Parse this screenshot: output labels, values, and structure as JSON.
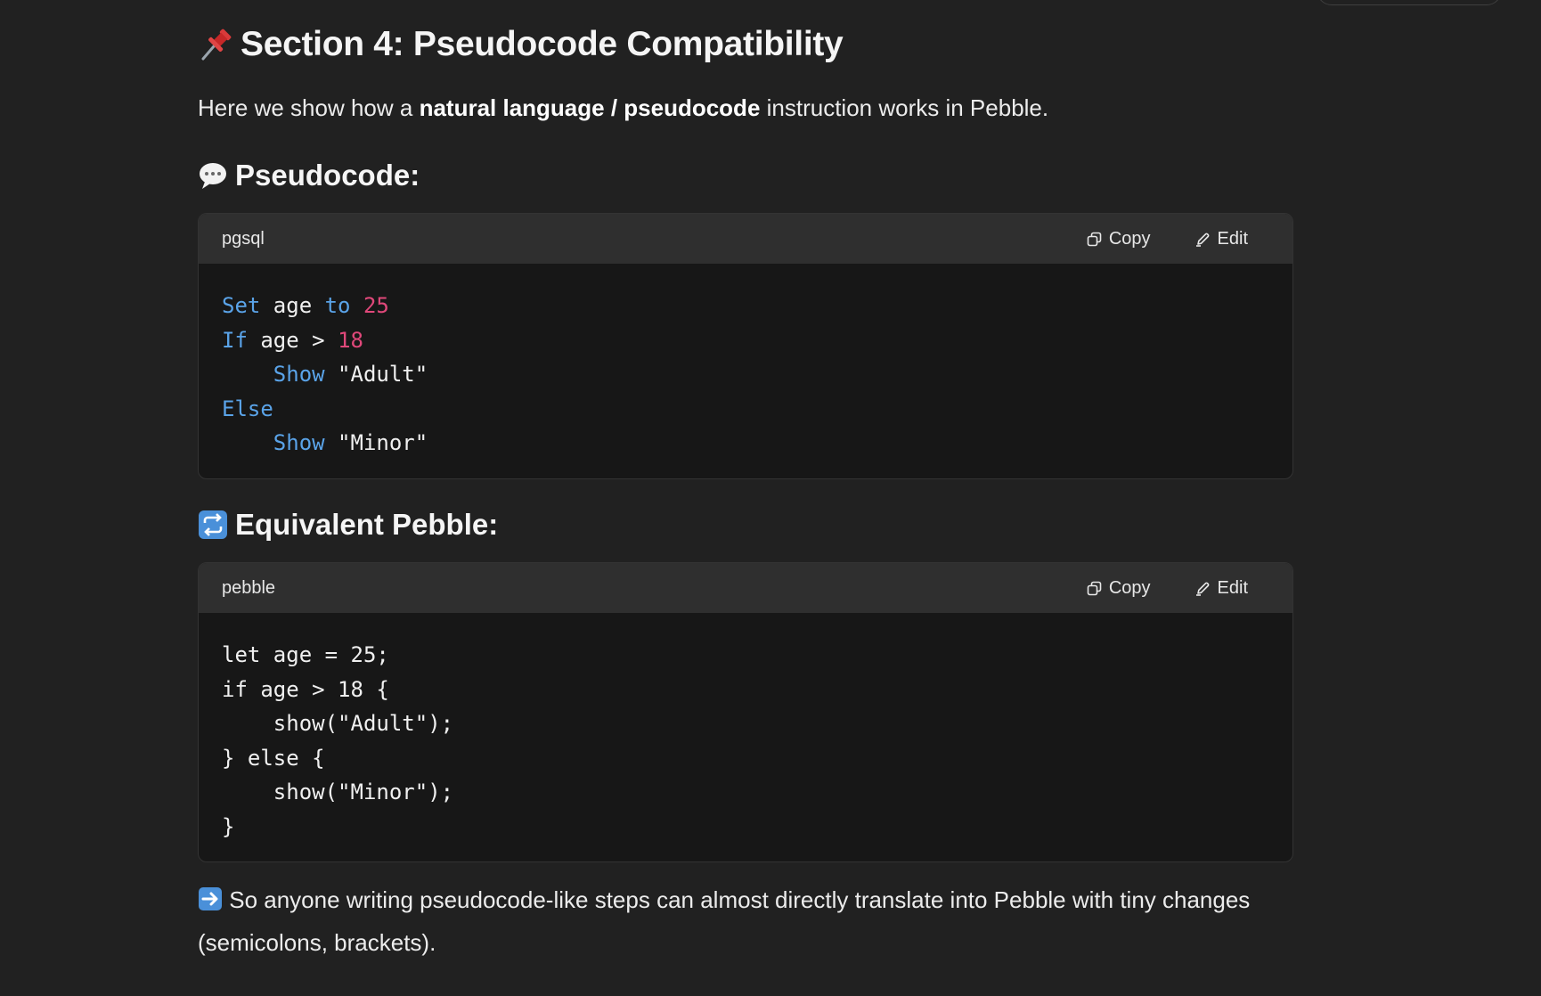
{
  "section": {
    "emoji": "📌",
    "title": "Section 4: Pseudocode Compatibility"
  },
  "intro": {
    "before": "Here we show how a ",
    "bold": "natural language / pseudocode",
    "after": " instruction works in Pebble."
  },
  "pseudocode_heading": {
    "emoji": "💬",
    "text": "Pseudocode:"
  },
  "pseudocode_block": {
    "language": "pgsql",
    "copy_label": "Copy",
    "edit_label": "Edit",
    "lines": [
      [
        {
          "t": "Set",
          "c": "kw"
        },
        {
          "t": " age "
        },
        {
          "t": "to",
          "c": "kw"
        },
        {
          "t": " "
        },
        {
          "t": "25",
          "c": "num"
        }
      ],
      [
        {
          "t": "If",
          "c": "kw"
        },
        {
          "t": " age > "
        },
        {
          "t": "18",
          "c": "num"
        }
      ],
      [
        {
          "t": "    "
        },
        {
          "t": "Show",
          "c": "kw"
        },
        {
          "t": " \"Adult\""
        }
      ],
      [
        {
          "t": "Else",
          "c": "kw"
        }
      ],
      [
        {
          "t": "    "
        },
        {
          "t": "Show",
          "c": "kw"
        },
        {
          "t": " \"Minor\""
        }
      ]
    ]
  },
  "pebble_heading": {
    "emoji": "🔁",
    "text": "Equivalent Pebble:"
  },
  "pebble_block": {
    "language": "pebble",
    "copy_label": "Copy",
    "edit_label": "Edit",
    "lines": [
      [
        {
          "t": "let age = 25;"
        }
      ],
      [
        {
          "t": "if age > 18 {"
        }
      ],
      [
        {
          "t": "    show(\"Adult\");"
        }
      ],
      [
        {
          "t": "} else {"
        }
      ],
      [
        {
          "t": "    show(\"Minor\");"
        }
      ],
      [
        {
          "t": "}"
        }
      ]
    ]
  },
  "footer": {
    "emoji": "➡️",
    "text": " So anyone writing pseudocode-like steps can almost directly translate into Pebble with tiny changes (semicolons, brackets)."
  },
  "colors": {
    "background": "#212121",
    "code_bg": "#171717",
    "code_header_bg": "#2f2f2f",
    "keyword": "#5aa3e8",
    "number": "#e0487a"
  }
}
